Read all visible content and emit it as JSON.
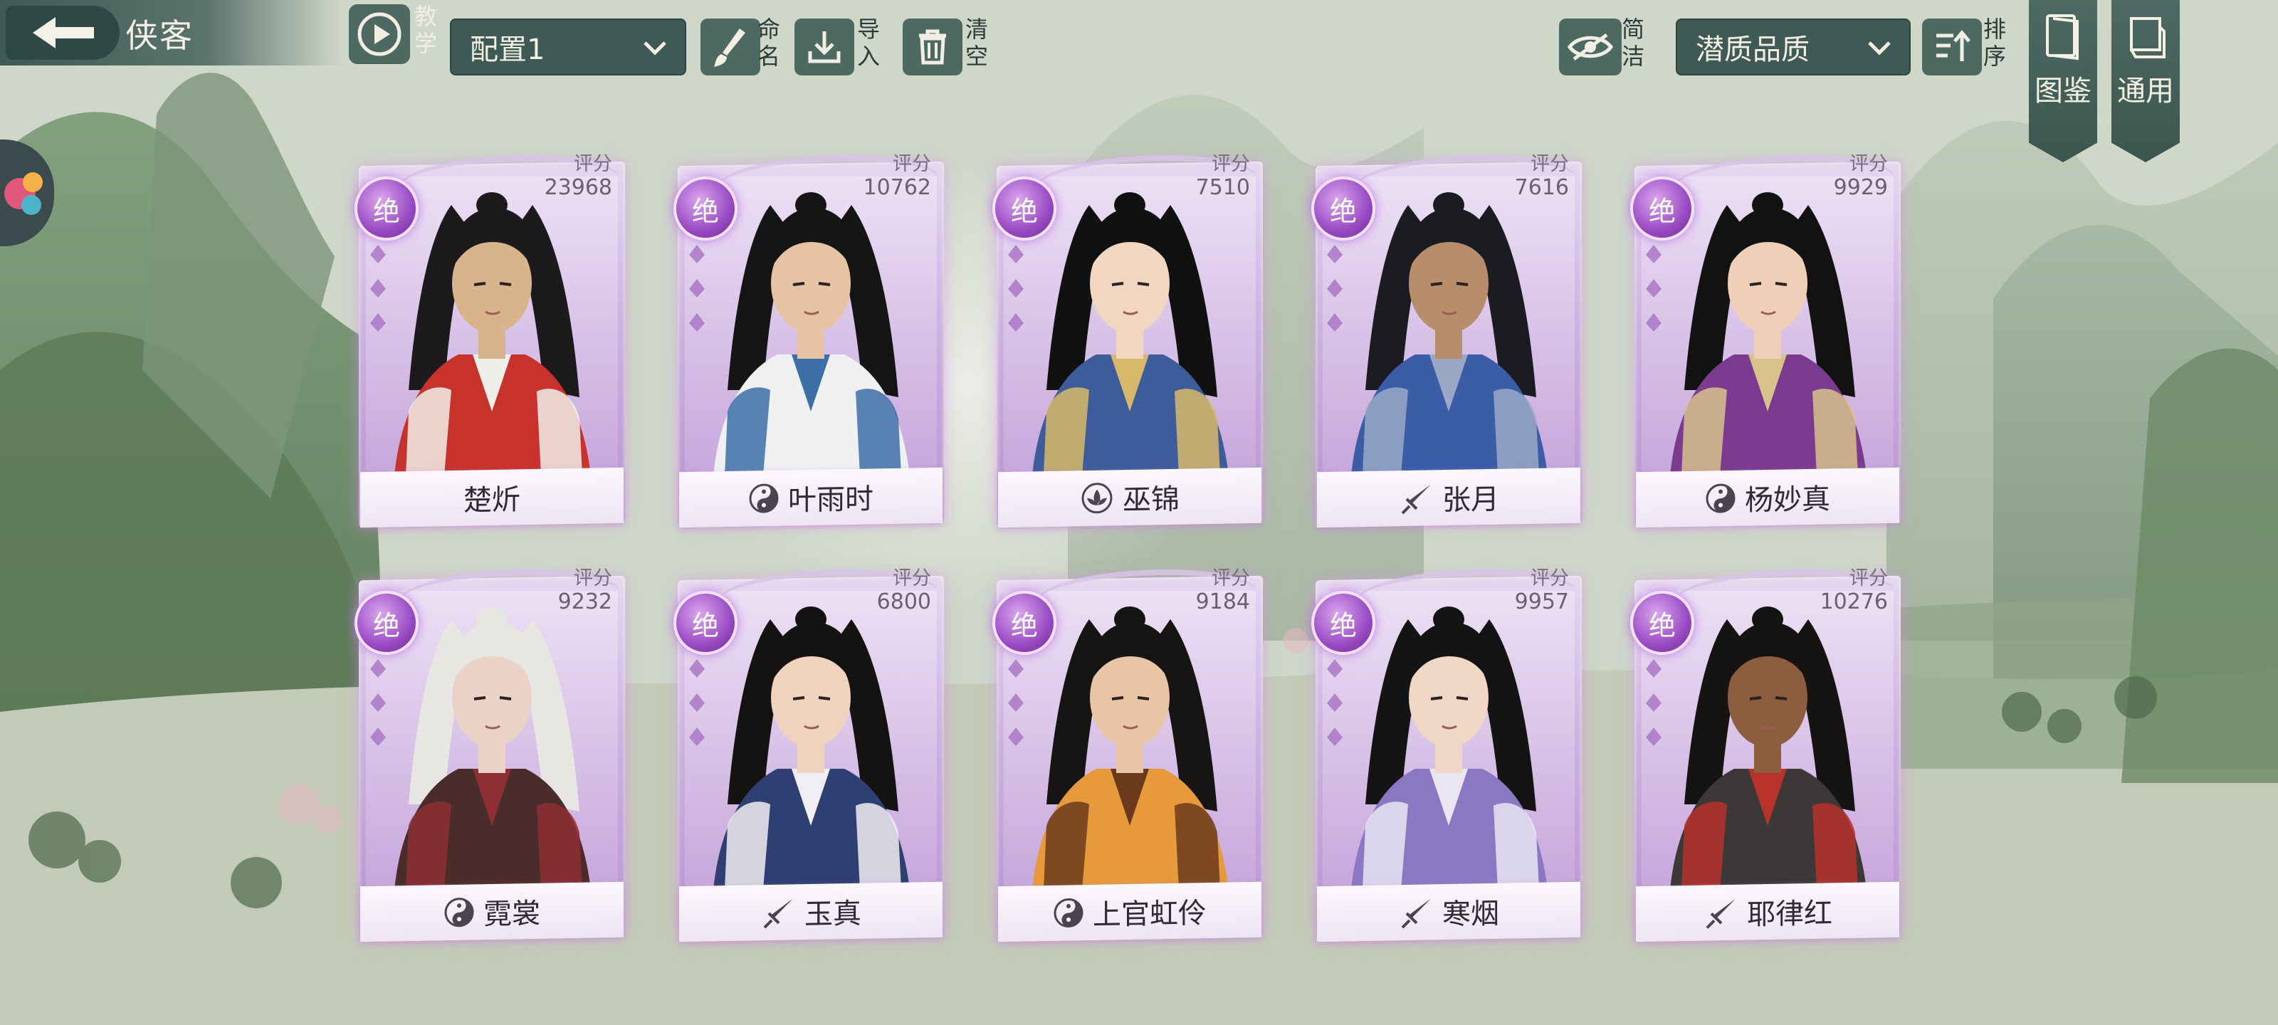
{
  "header": {
    "title": "侠客",
    "tutorial_label": "教学",
    "config_selected": "配置1",
    "rename_label": "命名",
    "import_label": "导入",
    "clear_label": "清空",
    "simple_label": "简洁",
    "sort_selected": "潜质品质",
    "sort_label": "排序",
    "atlas_label": "图鉴",
    "general_label": "通用"
  },
  "cards": [
    {
      "name": "楚炘",
      "score_label": "评分",
      "score": "23968",
      "rank": "绝",
      "faction_icon": "none",
      "skin": "#d9b38c",
      "hair": "#1c1a1c",
      "robe": "#c8322c",
      "robe2": "#f0eeea"
    },
    {
      "name": "叶雨时",
      "score_label": "评分",
      "score": "10762",
      "rank": "绝",
      "faction_icon": "yin-yang-icon",
      "skin": "#e6c3a2",
      "hair": "#151515",
      "robe": "#eef0f2",
      "robe2": "#3c6fa6"
    },
    {
      "name": "巫锦",
      "score_label": "评分",
      "score": "7510",
      "rank": "绝",
      "faction_icon": "lotus-icon",
      "skin": "#f1d6c2",
      "hair": "#111111",
      "robe": "#3e5c9a",
      "robe2": "#d7b86a"
    },
    {
      "name": "张月",
      "score_label": "评分",
      "score": "7616",
      "rank": "绝",
      "faction_icon": "sword-icon",
      "skin": "#b88d6c",
      "hair": "#1b1b22",
      "robe": "#3b5da8",
      "robe2": "#9aa8c6"
    },
    {
      "name": "杨妙真",
      "score_label": "评分",
      "score": "9929",
      "rank": "绝",
      "faction_icon": "yin-yang-icon",
      "skin": "#efcfb8",
      "hair": "#121212",
      "robe": "#7a3b8f",
      "robe2": "#d7c28c"
    },
    {
      "name": "霓裳",
      "score_label": "评分",
      "score": "9232",
      "rank": "绝",
      "faction_icon": "yin-yang-icon",
      "skin": "#e9d2c6",
      "hair": "#e8e6e2",
      "robe": "#4a2d2a",
      "robe2": "#8e2f34"
    },
    {
      "name": "玉真",
      "score_label": "评分",
      "score": "6800",
      "rank": "绝",
      "faction_icon": "sword-icon",
      "skin": "#f0d3bf",
      "hair": "#151212",
      "robe": "#2f3f72",
      "robe2": "#f1eef3"
    },
    {
      "name": "上官虹伶",
      "score_label": "评分",
      "score": "9184",
      "rank": "绝",
      "faction_icon": "yin-yang-icon",
      "skin": "#e8c5a5",
      "hair": "#171414",
      "robe": "#e69a3c",
      "robe2": "#6b3a1c"
    },
    {
      "name": "寒烟",
      "score_label": "评分",
      "score": "9957",
      "rank": "绝",
      "faction_icon": "sword-icon",
      "skin": "#f0d6c4",
      "hair": "#141414",
      "robe": "#8a78c2",
      "robe2": "#e9e5f3"
    },
    {
      "name": "耶律红",
      "score_label": "评分",
      "score": "10276",
      "rank": "绝",
      "faction_icon": "sword-icon",
      "skin": "#8c5e3f",
      "hair": "#161412",
      "robe": "#3b3837",
      "robe2": "#b8322c"
    }
  ],
  "colors": {
    "accent_purple": "#9a4bc3",
    "ui_teal": "#3f5954",
    "card_lilac": "#cdb2e0"
  }
}
